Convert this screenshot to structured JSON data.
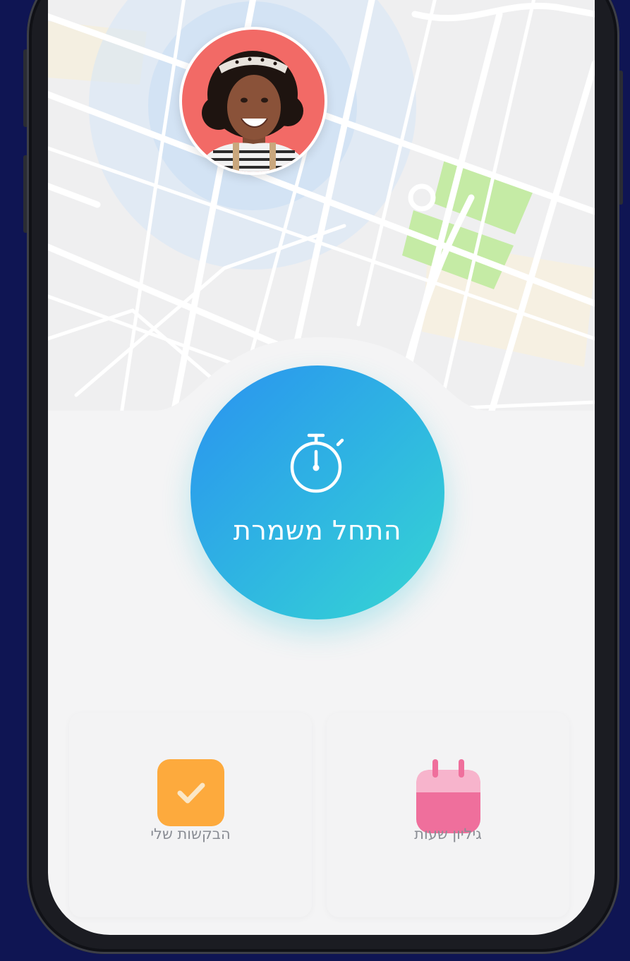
{
  "main": {
    "start_shift_label": "התחל משמרת"
  },
  "cards": {
    "requests_label": "הבקשות שלי",
    "timesheet_label": "גיליון שעות"
  },
  "icons": {
    "start_button": "stopwatch-icon",
    "requests": "checkmark-icon",
    "timesheet": "calendar-icon"
  },
  "colors": {
    "background": "#0f1553",
    "start_gradient_from": "#2a92f0",
    "start_gradient_to": "#36d6d3",
    "requests_icon": "#fdaa3d",
    "timesheet_icon": "#ef6f9c",
    "map_park": "#c5eba5"
  }
}
